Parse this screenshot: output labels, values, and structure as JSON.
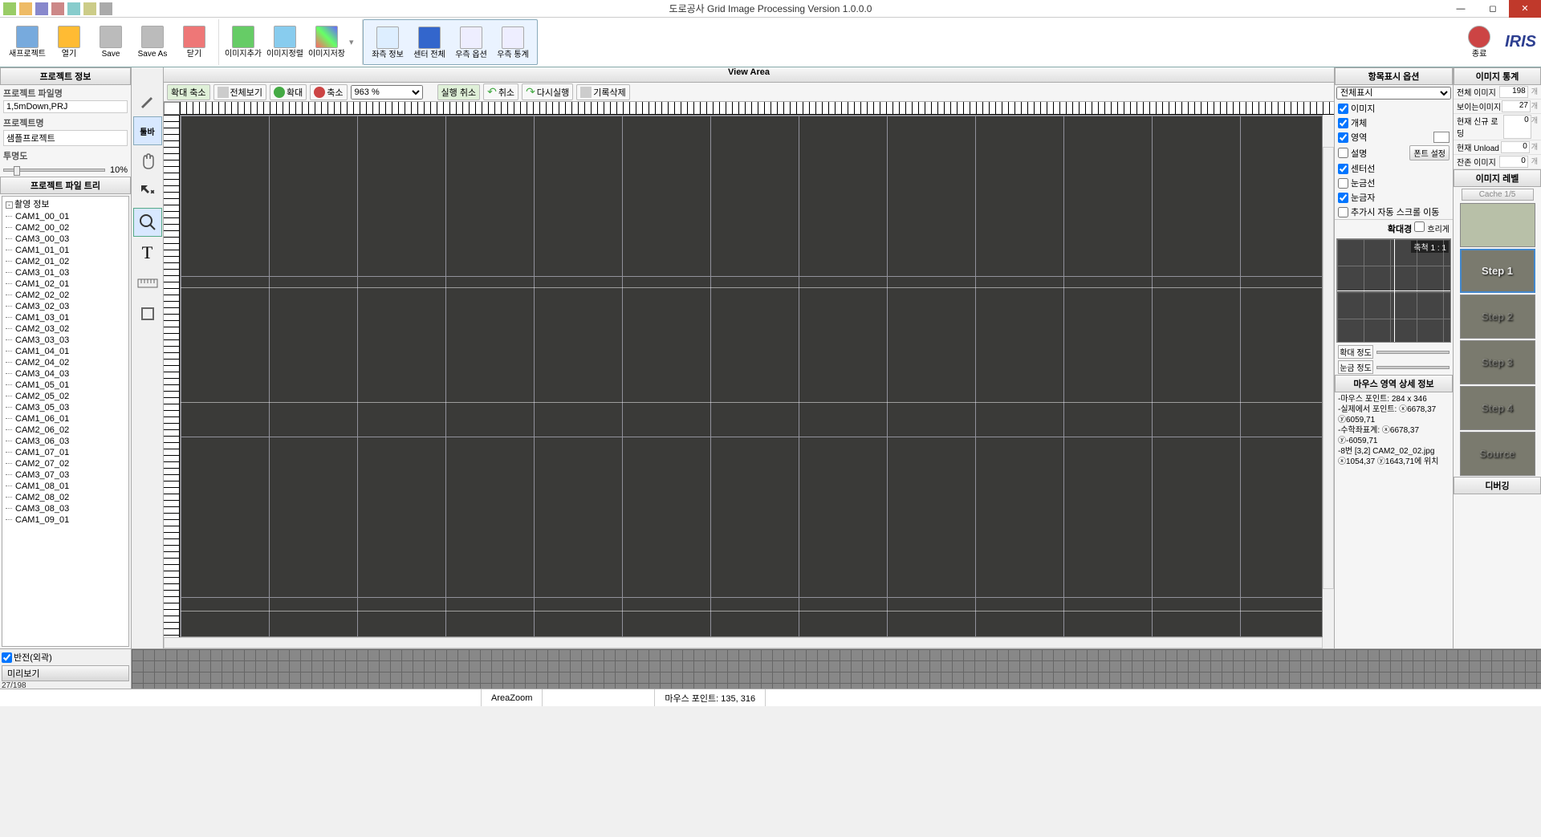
{
  "app": {
    "title": "도로공사 Grid Image Processing Version 1.0.0.0",
    "logo": "IRIS"
  },
  "ribbon": {
    "new_project": "새프로젝트",
    "open": "열기",
    "save": "Save",
    "save_as": "Save As",
    "close": "닫기",
    "image_add": "이미지추가",
    "image_align": "이미지정렬",
    "image_save": "이미지저장",
    "left_info": "좌측 정보",
    "center_all": "센터 전체",
    "right_option": "우측 옵션",
    "right_stats": "우측 통계",
    "exit": "종료"
  },
  "left": {
    "header_project": "프로젝트 정보",
    "filename_label": "프로젝트 파일명",
    "filename_value": "1,5mDown,PRJ",
    "projectname_label": "프로젝트명",
    "projectname_value": "샘플프로젝트",
    "opacity_label": "투명도",
    "opacity_value": "10%",
    "tree_header": "프로젝트 파일 트리",
    "tree_root": "촬영 정보",
    "tree_items": [
      "CAM1_00_01",
      "CAM2_00_02",
      "CAM3_00_03",
      "CAM1_01_01",
      "CAM2_01_02",
      "CAM3_01_03",
      "CAM1_02_01",
      "CAM2_02_02",
      "CAM3_02_03",
      "CAM1_03_01",
      "CAM2_03_02",
      "CAM3_03_03",
      "CAM1_04_01",
      "CAM2_04_02",
      "CAM3_04_03",
      "CAM1_05_01",
      "CAM2_05_02",
      "CAM3_05_03",
      "CAM1_06_01",
      "CAM2_06_02",
      "CAM3_06_03",
      "CAM1_07_01",
      "CAM2_07_02",
      "CAM3_07_03",
      "CAM1_08_01",
      "CAM2_08_02",
      "CAM3_08_03",
      "CAM1_09_01"
    ]
  },
  "toolstrip": {
    "toolbar_label": "툴바"
  },
  "center": {
    "title": "View Area",
    "zoom_group": "확대 축소",
    "view_all": "전체보기",
    "zoom_in": "확대",
    "zoom_out": "축소",
    "zoom_value": "963 %",
    "undo_group": "실행 취소",
    "undo": "취소",
    "redo": "다시실행",
    "clear_history": "기록삭제"
  },
  "preview": {
    "reverse_label": "반전(외곽)",
    "title": "미리보기",
    "count": "27/198"
  },
  "right": {
    "display_header": "항목표시 옵션",
    "select_all": "전체표시",
    "chk_image": "이미지",
    "chk_object": "개체",
    "chk_area": "영역",
    "chk_desc": "설명",
    "font_btn": "폰트 설정",
    "chk_center": "센터선",
    "chk_grid": "눈금선",
    "chk_ruler": "눈금자",
    "chk_autoscroll": "추가시 자동 스크롤 이동",
    "mag_header": "확대경",
    "chk_outline": "흐리게",
    "scale_label": "축척 1 : 1",
    "zoom_slider": "확대 정도",
    "grid_slider": "눈금 정도",
    "mouse_header": "마우스 영역 상세 정보",
    "mouse_line1": "-마우스 포인트: 284 x 346",
    "mouse_line2": "-실제에서 포인트: ⓧ6678,37 ⓨ6059,71",
    "mouse_line3": "-수학좌표계: ⓧ6678,37 ⓨ-6059,71",
    "mouse_line4": "-8번 [3,2] CAM2_02_02.jpg ⓧ1054,37 ⓨ1643,71에 위치"
  },
  "farright": {
    "stats_header": "이미지 통계",
    "total_label": "전체 이미지",
    "total_value": "198",
    "visible_label": "보이는이미지",
    "visible_value": "27",
    "newload_label": "현재 신규 로딩",
    "newload_value": "0",
    "unload_label": "현재 Unload",
    "unload_value": "0",
    "remain_label": "잔존 이미지",
    "remain_value": "0",
    "unit": "개",
    "level_header": "이미지 레벨",
    "cache_label": "Cache 1/5",
    "step1": "Step 1",
    "step2": "Step 2",
    "step3": "Step 3",
    "step4": "Step 4",
    "source": "Source",
    "debug_header": "디버깅"
  },
  "status": {
    "mode": "AreaZoom",
    "mouse": "마우스 포인트: 135, 316"
  }
}
